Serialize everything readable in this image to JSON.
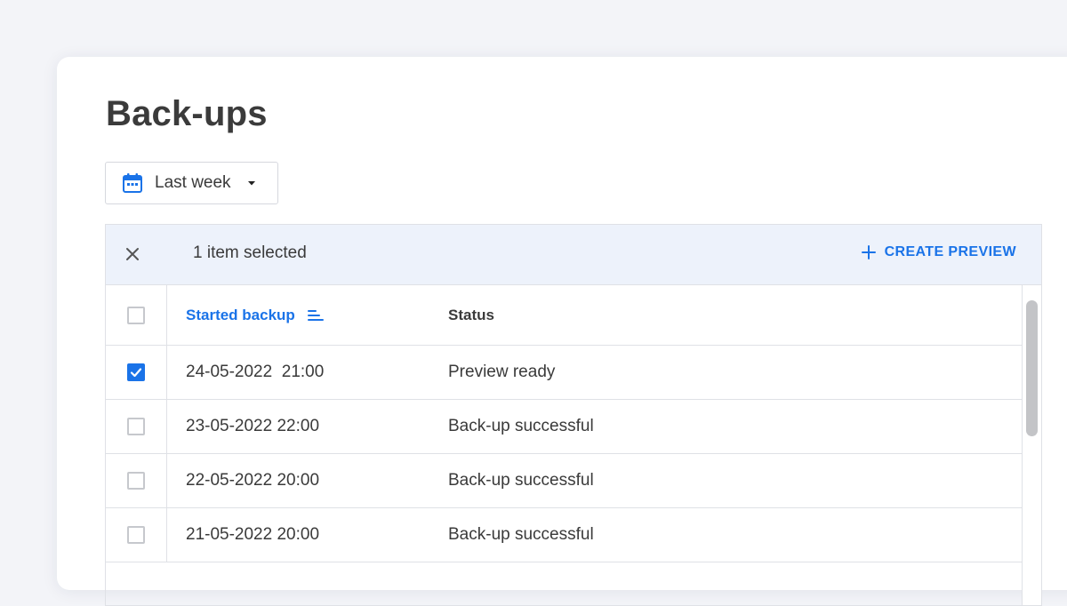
{
  "page": {
    "title": "Back-ups"
  },
  "filter": {
    "label": "Last week",
    "icon": "calendar-icon"
  },
  "selection_bar": {
    "count_text": "1 item selected",
    "create_label": "CREATE PREVIEW"
  },
  "table": {
    "headers": {
      "started": "Started backup",
      "status": "Status"
    },
    "rows": [
      {
        "started": "24-05-2022  21:00",
        "status": "Preview ready",
        "checked": true
      },
      {
        "started": "23-05-2022 22:00",
        "status": "Back-up successful",
        "checked": false
      },
      {
        "started": "22-05-2022 20:00",
        "status": "Back-up successful",
        "checked": false
      },
      {
        "started": "21-05-2022 20:00",
        "status": "Back-up successful",
        "checked": false
      }
    ]
  },
  "colors": {
    "accent": "#1a73e8",
    "selection_bg": "#edf2fb",
    "border": "#dfe1e6"
  }
}
